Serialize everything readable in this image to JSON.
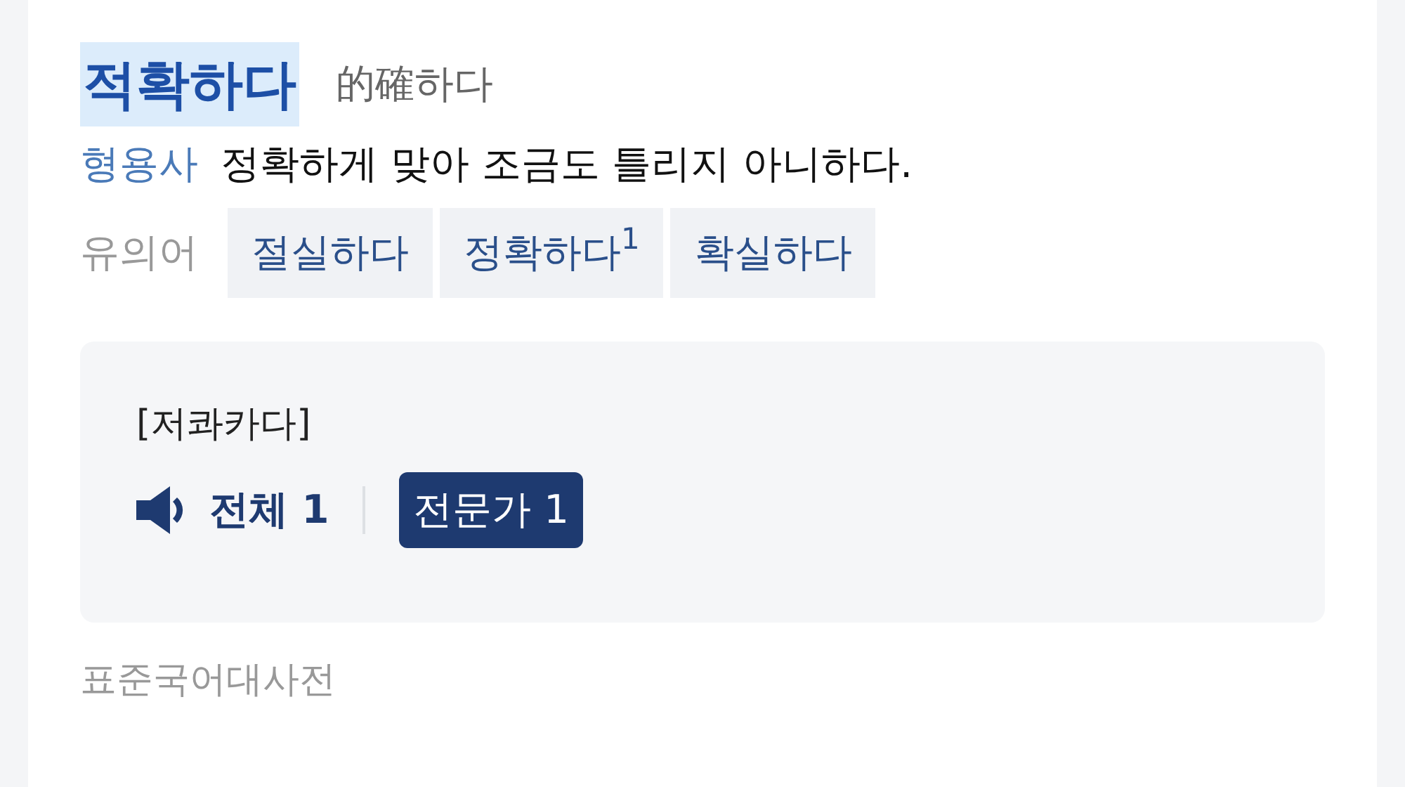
{
  "entry": {
    "headword": "적확하다",
    "headword_highlighted": true,
    "origin": "的確하다"
  },
  "sense": {
    "part_of_speech": "형용사",
    "definition": "정확하게 맞아 조금도 틀리지 아니하다."
  },
  "synonyms": {
    "label": "유의어",
    "items": [
      "절실하다",
      "정확하다$^{1}$",
      "확실하다"
    ]
  },
  "pronunciation": {
    "reading": "[저콰카다]",
    "filters": [
      {
        "label": "전체 1",
        "kind": "audio",
        "selected": false
      },
      {
        "label": "전문가 1",
        "kind": "text",
        "selected": true
      }
    ]
  },
  "source": "표준국어대사전"
}
